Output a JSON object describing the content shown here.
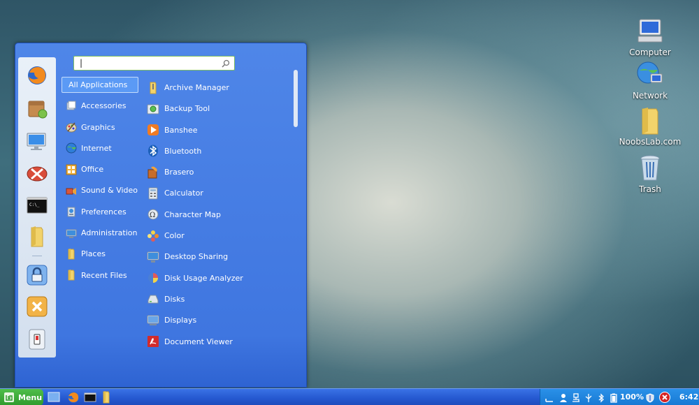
{
  "desktop": {
    "icons": [
      {
        "label": "Computer",
        "icon": "computer-icon"
      },
      {
        "label": "Network",
        "icon": "network-icon"
      },
      {
        "label": "NoobsLab.com",
        "icon": "folder-icon"
      },
      {
        "label": "Trash",
        "icon": "trash-icon"
      }
    ]
  },
  "menu": {
    "search": {
      "value": "|",
      "placeholder": ""
    },
    "favorites": [
      {
        "icon": "firefox-icon"
      },
      {
        "icon": "software-manager-icon"
      },
      {
        "icon": "system-settings-icon"
      },
      {
        "icon": "synaptic-icon"
      },
      {
        "icon": "terminal-icon"
      },
      {
        "icon": "home-folder-icon"
      },
      {
        "icon": "lock-screen-icon"
      },
      {
        "icon": "logout-icon"
      },
      {
        "icon": "shutdown-icon"
      }
    ],
    "categories": [
      {
        "label": "All Applications",
        "selected": true
      },
      {
        "label": "Accessories"
      },
      {
        "label": "Graphics"
      },
      {
        "label": "Internet"
      },
      {
        "label": "Office"
      },
      {
        "label": "Sound & Video"
      },
      {
        "label": "Preferences"
      },
      {
        "label": "Administration"
      },
      {
        "label": "Places"
      },
      {
        "label": "Recent Files"
      }
    ],
    "apps": [
      {
        "label": "Archive Manager"
      },
      {
        "label": "Backup Tool"
      },
      {
        "label": "Banshee"
      },
      {
        "label": "Bluetooth"
      },
      {
        "label": "Brasero"
      },
      {
        "label": "Calculator"
      },
      {
        "label": "Character Map"
      },
      {
        "label": "Color"
      },
      {
        "label": "Desktop Sharing"
      },
      {
        "label": "Disk Usage Analyzer"
      },
      {
        "label": "Disks"
      },
      {
        "label": "Displays"
      },
      {
        "label": "Document Viewer"
      }
    ]
  },
  "taskbar": {
    "menu_label": "Menu",
    "battery": "100%",
    "clock": "6:42"
  },
  "colors": {
    "menu_bg": "#3f76e0",
    "taskbar_bg": "#2558cf",
    "menu_button": "#3aa836",
    "selected_category": "#5b9af5"
  }
}
